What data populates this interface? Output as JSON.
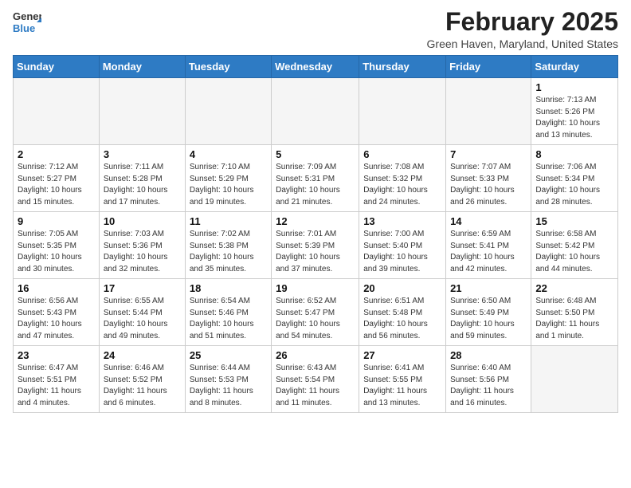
{
  "header": {
    "logo_general": "General",
    "logo_blue": "Blue",
    "month_year": "February 2025",
    "location": "Green Haven, Maryland, United States"
  },
  "days_of_week": [
    "Sunday",
    "Monday",
    "Tuesday",
    "Wednesday",
    "Thursday",
    "Friday",
    "Saturday"
  ],
  "weeks": [
    [
      {
        "num": "",
        "info": ""
      },
      {
        "num": "",
        "info": ""
      },
      {
        "num": "",
        "info": ""
      },
      {
        "num": "",
        "info": ""
      },
      {
        "num": "",
        "info": ""
      },
      {
        "num": "",
        "info": ""
      },
      {
        "num": "1",
        "info": "Sunrise: 7:13 AM\nSunset: 5:26 PM\nDaylight: 10 hours and 13 minutes."
      }
    ],
    [
      {
        "num": "2",
        "info": "Sunrise: 7:12 AM\nSunset: 5:27 PM\nDaylight: 10 hours and 15 minutes."
      },
      {
        "num": "3",
        "info": "Sunrise: 7:11 AM\nSunset: 5:28 PM\nDaylight: 10 hours and 17 minutes."
      },
      {
        "num": "4",
        "info": "Sunrise: 7:10 AM\nSunset: 5:29 PM\nDaylight: 10 hours and 19 minutes."
      },
      {
        "num": "5",
        "info": "Sunrise: 7:09 AM\nSunset: 5:31 PM\nDaylight: 10 hours and 21 minutes."
      },
      {
        "num": "6",
        "info": "Sunrise: 7:08 AM\nSunset: 5:32 PM\nDaylight: 10 hours and 24 minutes."
      },
      {
        "num": "7",
        "info": "Sunrise: 7:07 AM\nSunset: 5:33 PM\nDaylight: 10 hours and 26 minutes."
      },
      {
        "num": "8",
        "info": "Sunrise: 7:06 AM\nSunset: 5:34 PM\nDaylight: 10 hours and 28 minutes."
      }
    ],
    [
      {
        "num": "9",
        "info": "Sunrise: 7:05 AM\nSunset: 5:35 PM\nDaylight: 10 hours and 30 minutes."
      },
      {
        "num": "10",
        "info": "Sunrise: 7:03 AM\nSunset: 5:36 PM\nDaylight: 10 hours and 32 minutes."
      },
      {
        "num": "11",
        "info": "Sunrise: 7:02 AM\nSunset: 5:38 PM\nDaylight: 10 hours and 35 minutes."
      },
      {
        "num": "12",
        "info": "Sunrise: 7:01 AM\nSunset: 5:39 PM\nDaylight: 10 hours and 37 minutes."
      },
      {
        "num": "13",
        "info": "Sunrise: 7:00 AM\nSunset: 5:40 PM\nDaylight: 10 hours and 39 minutes."
      },
      {
        "num": "14",
        "info": "Sunrise: 6:59 AM\nSunset: 5:41 PM\nDaylight: 10 hours and 42 minutes."
      },
      {
        "num": "15",
        "info": "Sunrise: 6:58 AM\nSunset: 5:42 PM\nDaylight: 10 hours and 44 minutes."
      }
    ],
    [
      {
        "num": "16",
        "info": "Sunrise: 6:56 AM\nSunset: 5:43 PM\nDaylight: 10 hours and 47 minutes."
      },
      {
        "num": "17",
        "info": "Sunrise: 6:55 AM\nSunset: 5:44 PM\nDaylight: 10 hours and 49 minutes."
      },
      {
        "num": "18",
        "info": "Sunrise: 6:54 AM\nSunset: 5:46 PM\nDaylight: 10 hours and 51 minutes."
      },
      {
        "num": "19",
        "info": "Sunrise: 6:52 AM\nSunset: 5:47 PM\nDaylight: 10 hours and 54 minutes."
      },
      {
        "num": "20",
        "info": "Sunrise: 6:51 AM\nSunset: 5:48 PM\nDaylight: 10 hours and 56 minutes."
      },
      {
        "num": "21",
        "info": "Sunrise: 6:50 AM\nSunset: 5:49 PM\nDaylight: 10 hours and 59 minutes."
      },
      {
        "num": "22",
        "info": "Sunrise: 6:48 AM\nSunset: 5:50 PM\nDaylight: 11 hours and 1 minute."
      }
    ],
    [
      {
        "num": "23",
        "info": "Sunrise: 6:47 AM\nSunset: 5:51 PM\nDaylight: 11 hours and 4 minutes."
      },
      {
        "num": "24",
        "info": "Sunrise: 6:46 AM\nSunset: 5:52 PM\nDaylight: 11 hours and 6 minutes."
      },
      {
        "num": "25",
        "info": "Sunrise: 6:44 AM\nSunset: 5:53 PM\nDaylight: 11 hours and 8 minutes."
      },
      {
        "num": "26",
        "info": "Sunrise: 6:43 AM\nSunset: 5:54 PM\nDaylight: 11 hours and 11 minutes."
      },
      {
        "num": "27",
        "info": "Sunrise: 6:41 AM\nSunset: 5:55 PM\nDaylight: 11 hours and 13 minutes."
      },
      {
        "num": "28",
        "info": "Sunrise: 6:40 AM\nSunset: 5:56 PM\nDaylight: 11 hours and 16 minutes."
      },
      {
        "num": "",
        "info": ""
      }
    ]
  ]
}
